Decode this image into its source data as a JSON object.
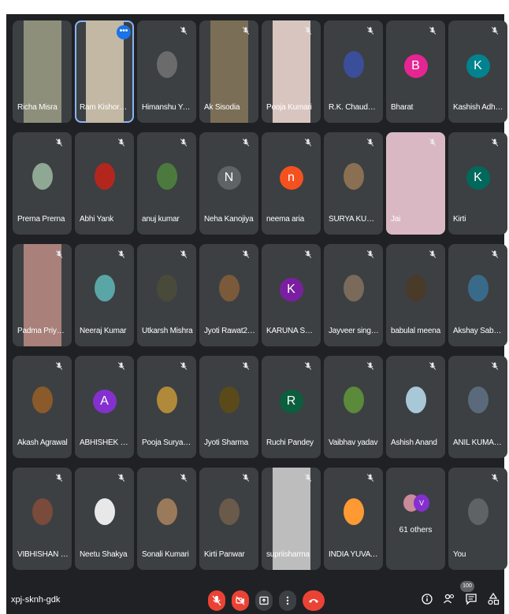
{
  "meeting": {
    "code": "xpj-sknh-gdk",
    "participant_badge": "100"
  },
  "participants": [
    {
      "name": "Richa Misra",
      "kind": "video",
      "color": "#8d8f7a"
    },
    {
      "name": "Ram Kishore Ya...",
      "kind": "video",
      "color": "#c2b8a3"
    },
    {
      "name": "Himanshu Yadav",
      "kind": "photo",
      "color": "#6b6b6b"
    },
    {
      "name": "Ak Sisodia",
      "kind": "video",
      "color": "#7b6e56"
    },
    {
      "name": "Pooja Kumari",
      "kind": "video",
      "color": "#d9c5c0"
    },
    {
      "name": "R.K. Chaudhary",
      "kind": "photo",
      "color": "#3b4e9a"
    },
    {
      "name": "Bharat",
      "kind": "letter",
      "letter": "B",
      "color": "#e52592"
    },
    {
      "name": "Kashish Adhikari",
      "kind": "letter",
      "letter": "K",
      "color": "#00838f"
    },
    {
      "name": "Prerna Prerna",
      "kind": "photo",
      "color": "#8fa894"
    },
    {
      "name": "Abhi Yank",
      "kind": "photo",
      "color": "#b3261e"
    },
    {
      "name": "anuj kumar",
      "kind": "photo",
      "color": "#4c7a3e"
    },
    {
      "name": "Neha Kanojiya",
      "kind": "letter",
      "letter": "N",
      "color": "#5f6368"
    },
    {
      "name": "neema aria",
      "kind": "letter",
      "letter": "n",
      "color": "#f4511e"
    },
    {
      "name": "SURYA KUMAR ...",
      "kind": "photo",
      "color": "#8a6f52"
    },
    {
      "name": "Jai",
      "kind": "video",
      "color": "#d9b8c4"
    },
    {
      "name": "Kirti",
      "kind": "letter",
      "letter": "K",
      "color": "#00695c"
    },
    {
      "name": "Padma Priyada...",
      "kind": "video",
      "color": "#a9807a"
    },
    {
      "name": "Neeraj Kumar",
      "kind": "photo",
      "color": "#5aa5a5"
    },
    {
      "name": "Utkarsh Mishra",
      "kind": "photo",
      "color": "#4a4a3a"
    },
    {
      "name": "Jyoti Rawat2000",
      "kind": "photo",
      "color": "#7a5a3a"
    },
    {
      "name": "KARUNA SAINI",
      "kind": "letter",
      "letter": "K",
      "color": "#7b1fa2"
    },
    {
      "name": "Jayveer singh J...",
      "kind": "photo",
      "color": "#7a6a5a"
    },
    {
      "name": "babulal meena",
      "kind": "photo",
      "color": "#4a3a2a"
    },
    {
      "name": "Akshay Sabharwal",
      "kind": "photo",
      "color": "#3a6a8a"
    },
    {
      "name": "Akash Agrawal",
      "kind": "photo",
      "color": "#8a5a2a"
    },
    {
      "name": "ABHISHEK BAGH",
      "kind": "letter",
      "letter": "A",
      "color": "#8430ce"
    },
    {
      "name": "Pooja Suryavans...",
      "kind": "photo",
      "color": "#b08a3a"
    },
    {
      "name": "Jyoti Sharma",
      "kind": "photo",
      "color": "#5a4a1a"
    },
    {
      "name": "Ruchi Pandey",
      "kind": "letter",
      "letter": "R",
      "color": "#0b5e3e"
    },
    {
      "name": "Vaibhav yadav",
      "kind": "photo",
      "color": "#5a8a3a"
    },
    {
      "name": "Ashish Anand",
      "kind": "photo",
      "color": "#a8c8d8"
    },
    {
      "name": "ANIL KUMAR BE...",
      "kind": "photo",
      "color": "#5a6a7a"
    },
    {
      "name": "VIBHISHAN KUM...",
      "kind": "photo",
      "color": "#7a4a3a"
    },
    {
      "name": "Neetu Shakya",
      "kind": "photo",
      "color": "#e8e8e8"
    },
    {
      "name": "Sonali Kumari",
      "kind": "photo",
      "color": "#9a7a5a"
    },
    {
      "name": "Kirti Panwar",
      "kind": "photo",
      "color": "#6a5a4a"
    },
    {
      "name": "supriisharma",
      "kind": "video",
      "color": "#bdbdbd"
    },
    {
      "name": "INDIA YUVA CH...",
      "kind": "photo",
      "color": "#ff9933"
    },
    {
      "name": "61 others",
      "kind": "others"
    },
    {
      "name": "You",
      "kind": "photo",
      "color": "#5f6368"
    }
  ],
  "others_avatar_letter": "V",
  "icons": {
    "mic": "mic-off-icon",
    "camera": "camera-off-icon",
    "present": "present-icon",
    "more": "more-options-icon",
    "end": "end-call-icon",
    "info": "info-icon",
    "people": "people-icon",
    "chat": "chat-icon",
    "activities": "activities-icon"
  },
  "colors": {
    "stage": "#202124",
    "tile": "#3c4043",
    "end_call": "#ea4335",
    "active_border": "#8ab4f8"
  }
}
